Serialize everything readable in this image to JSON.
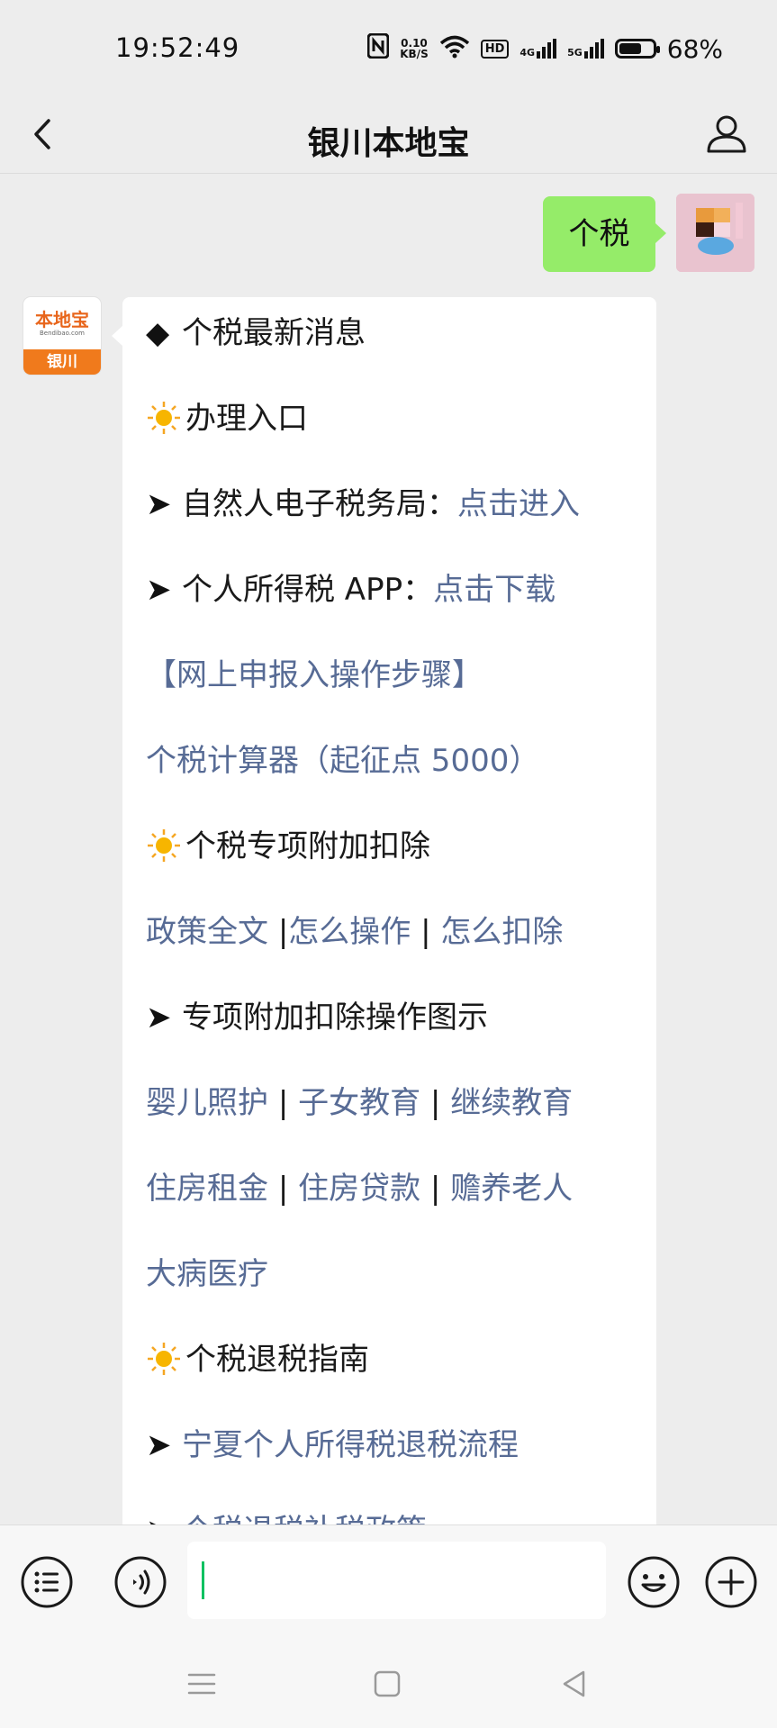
{
  "status_bar": {
    "time": "19:52:49",
    "net_speed_value": "0.10",
    "net_speed_unit": "KB/S",
    "hd_badge": "HD",
    "signal_1": "4G",
    "signal_2": "5G",
    "battery_percent": "68%",
    "battery_level": 0.68,
    "icons": [
      "nfc-icon",
      "wifi-icon",
      "hd-icon",
      "signal-4g-icon",
      "signal-5g-icon",
      "battery-icon"
    ]
  },
  "nav": {
    "title": "银川本地宝",
    "back_icon": "chevron-left-icon",
    "profile_icon": "person-icon"
  },
  "chat": {
    "user_message": "个税",
    "bot_avatar": {
      "logo_text": "本地宝",
      "logo_sub": "Bendibao.com",
      "city": "银川"
    },
    "lines": {
      "l1_prefix": "◆",
      "l1_text": "个税最新消息",
      "l2_text": "办理入口",
      "l3_prefix": "➤",
      "l3_text": "自然人电子税务局：",
      "l3_link": "点击进入",
      "l4_prefix": "➤",
      "l4_text": "个人所得税 APP：",
      "l4_link": "点击下载",
      "l5_link": "【网上申报入操作步骤】",
      "l6_link": "个税计算器（起征点 5000）",
      "l7_text": "个税专项附加扣除",
      "l8_link1": "政策全文",
      "l8_link2": "怎么操作",
      "l8_link3": "怎么扣除",
      "sep": "|",
      "l9_prefix": "➤",
      "l9_text": "专项附加扣除操作图示",
      "l10_link1": "婴儿照护",
      "l10_link2": "子女教育",
      "l10_link3": "继续教育",
      "l11_link1": "住房租金",
      "l11_link2": "住房贷款",
      "l11_link3": "赡养老人",
      "l12_link": "大病医疗",
      "l13_text": "个税退税指南",
      "l14_prefix": "➤",
      "l14_link": "宁夏个人所得税退税流程",
      "l15_prefix": "➤",
      "l15_text": "个税退税补税政策"
    }
  },
  "input_bar": {
    "icons": [
      "menu-icon",
      "voice-icon",
      "emoji-icon",
      "plus-icon"
    ],
    "caret_color": "#07c160"
  },
  "system_nav": {
    "icons": [
      "recent-apps-icon",
      "home-icon",
      "back-icon"
    ]
  },
  "colors": {
    "background": "#ededed",
    "link": "#576b95",
    "user_bubble": "#95ec69",
    "brand_orange": "#f07a1c"
  }
}
